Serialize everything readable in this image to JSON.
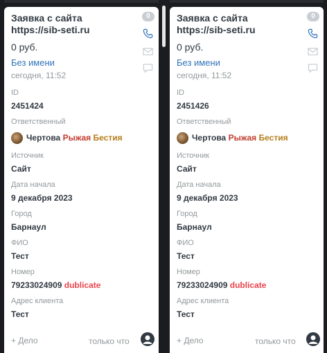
{
  "colors": {
    "accent_link": "#2f73b9",
    "duplicate_red": "#e8434b",
    "muted_text": "#92989b",
    "primary_text": "#313942",
    "board_background": "#1b1c20"
  },
  "labels": {
    "id": "ID",
    "responsible": "Ответственный",
    "source": "Источник",
    "start_date": "Дата начала",
    "city": "Город",
    "fio": "ФИО",
    "number": "Номер",
    "client_address": "Адрес клиента"
  },
  "cards": [
    {
      "title": "Заявка с сайта https://sib-seti.ru",
      "counter": "0",
      "price": "0 руб.",
      "contact_name": "Без имени",
      "created": "сегодня, 11:52",
      "id": "2451424",
      "responsible": {
        "part1": "Чертова",
        "part2": "Рыжая",
        "part3": "Бестия"
      },
      "source": "Сайт",
      "start_date": "9 декабря 2023",
      "city": "Барнаул",
      "fio": "Тест",
      "number": "79233024909",
      "duplicate_tag": "dublicate",
      "client_address": "Тест",
      "add_label": "+ Дело",
      "when": "только что"
    },
    {
      "title": "Заявка с сайта https://sib-seti.ru",
      "counter": "0",
      "price": "0 руб.",
      "contact_name": "Без имени",
      "created": "сегодня, 11:52",
      "id": "2451426",
      "responsible": {
        "part1": "Чертова",
        "part2": "Рыжая",
        "part3": "Бестия"
      },
      "source": "Сайт",
      "start_date": "9 декабря 2023",
      "city": "Барнаул",
      "fio": "Тест",
      "number": "79233024909",
      "duplicate_tag": "dublicate",
      "client_address": "Тест",
      "add_label": "+ Дело",
      "when": "только что"
    }
  ],
  "icons": [
    "phone-icon",
    "mail-icon",
    "chat-icon",
    "user-avatar-icon"
  ]
}
